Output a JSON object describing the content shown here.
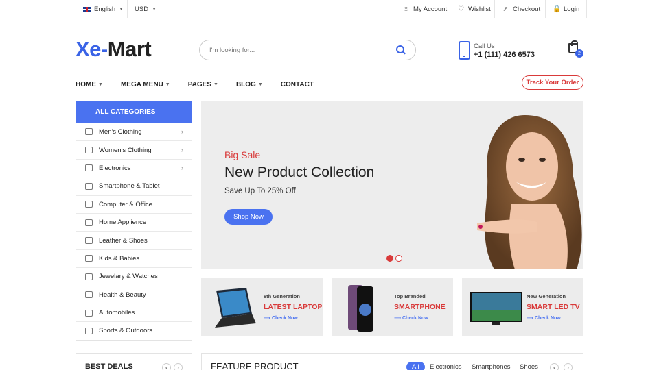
{
  "topbar": {
    "language": "English",
    "currency": "USD",
    "links": [
      "My Account",
      "Wishlist",
      "Checkout",
      "Login"
    ]
  },
  "header": {
    "logo_part1": "Xe-",
    "logo_part2": "Mart",
    "search_placeholder": "I'm looking for...",
    "call_label": "Call Us",
    "call_number": "+1 (111) 426 6573",
    "cart_count": "2"
  },
  "nav": {
    "items": [
      "HOME",
      "MEGA MENU",
      "PAGES",
      "BLOG",
      "CONTACT"
    ],
    "track_order": "Track Your Order"
  },
  "sidebar": {
    "heading": "ALL CATEGORIES",
    "items": [
      {
        "label": "Men's Clothing",
        "arrow": true
      },
      {
        "label": "Women's Clothing",
        "arrow": true
      },
      {
        "label": "Electronics",
        "arrow": true
      },
      {
        "label": "Smartphone & Tablet",
        "arrow": false
      },
      {
        "label": "Computer & Office",
        "arrow": false
      },
      {
        "label": "Home Applience",
        "arrow": false
      },
      {
        "label": "Leather & Shoes",
        "arrow": false
      },
      {
        "label": "Kids & Babies",
        "arrow": false
      },
      {
        "label": "Jewelary & Watches",
        "arrow": false
      },
      {
        "label": "Health & Beauty",
        "arrow": false
      },
      {
        "label": "Automobiles",
        "arrow": false
      },
      {
        "label": "Sports & Outdoors",
        "arrow": false
      }
    ]
  },
  "hero": {
    "subtitle": "Big Sale",
    "title": "New Product Collection",
    "description": "Save Up To 25% Off",
    "button": "Shop Now",
    "slide_count": 2,
    "active_slide": 1
  },
  "promos": [
    {
      "small": "8th Generation",
      "title": "LATEST LAPTOP",
      "link": "Check Now"
    },
    {
      "small": "Top Branded",
      "title": "SMARTPHONE",
      "link": "Check Now"
    },
    {
      "small": "New Generation",
      "title": "SMART LED TV",
      "link": "Check Now"
    }
  ],
  "best_deals": {
    "title": "BEST DEALS"
  },
  "feature": {
    "title": "FEATURE PRODUCT",
    "tabs": [
      "All",
      "Electronics",
      "Smartphones",
      "Shoes"
    ],
    "active_tab": "All"
  },
  "colors": {
    "accent": "#4a72f0",
    "sale_red": "#d93a3a"
  }
}
